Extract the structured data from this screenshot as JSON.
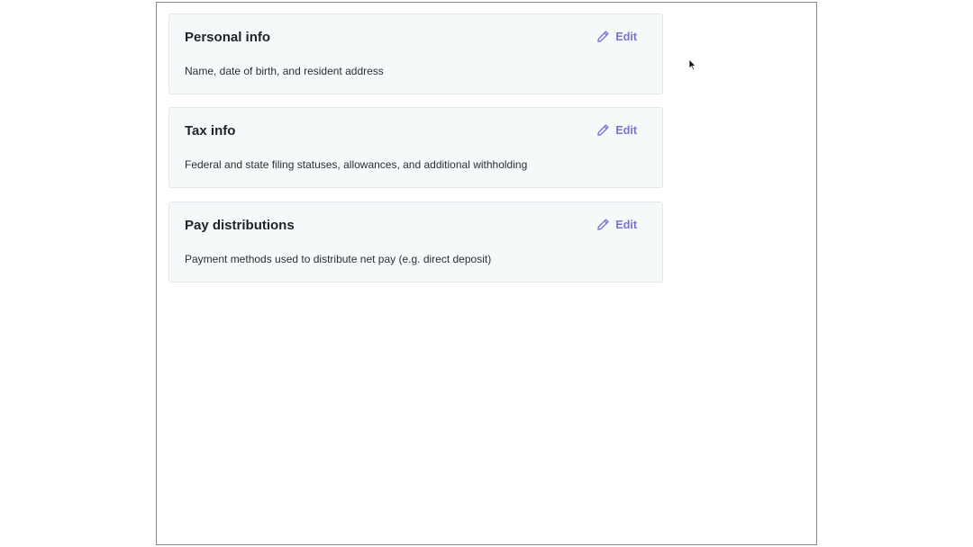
{
  "cards": [
    {
      "title": "Personal info",
      "description": "Name, date of birth, and resident address",
      "edit_label": "Edit"
    },
    {
      "title": "Tax info",
      "description": "Federal and state filing statuses, allowances, and additional withholding",
      "edit_label": "Edit"
    },
    {
      "title": "Pay distributions",
      "description": "Payment methods used to distribute net pay (e.g. direct deposit)",
      "edit_label": "Edit"
    }
  ],
  "colors": {
    "accent": "#7b6fd0",
    "card_background": "#f5f9f9",
    "card_border": "#e3e8ea"
  },
  "icons": {
    "edit": "pencil-icon",
    "cursor": "mouse-pointer-icon"
  }
}
